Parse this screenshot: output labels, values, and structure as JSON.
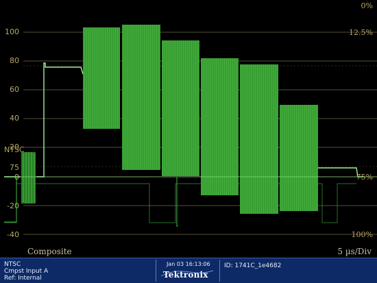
{
  "scale": {
    "left_labels": [
      "100",
      "80",
      "60",
      "40",
      "20",
      "0",
      "NTSC",
      "75",
      "-20",
      "-40"
    ],
    "right_labels": [
      "0%",
      "12.5%",
      "75%",
      "100%"
    ]
  },
  "status_bar": {
    "standard": "NTSC",
    "input": "Cmpst Input A",
    "ref": "Ref: Internal",
    "timestamp": "Jan 03 16:13:06",
    "brand": "Tektronix",
    "id": "ID: 1741C_1e4682"
  },
  "display": {
    "mode": "Composite",
    "timebase": "5 µs/Div"
  },
  "colors": {
    "trace": "#69f25f",
    "graticule": "#b9a866",
    "status_bg": "#0d2a66"
  }
}
